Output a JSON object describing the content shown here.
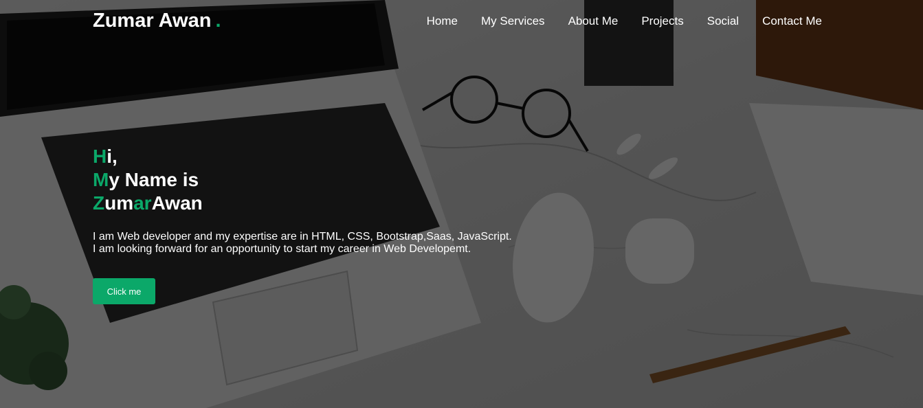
{
  "navbar": {
    "brand_name": "Zumar Awan",
    "brand_dot": ".",
    "links": [
      "Home",
      "My Services",
      "About Me",
      "Projects",
      "Social",
      "Contact Me"
    ]
  },
  "hero": {
    "line1": {
      "accent": "H",
      "rest": "i,"
    },
    "line2": {
      "accent": "M",
      "rest": "y Name is"
    },
    "line3": {
      "accent1": "Z",
      "mid": "um",
      "accent2": "ar",
      "rest": "Awan"
    },
    "description_line1": "I am Web developer and my expertise are in HTML, CSS, Bootstrap,Saas, JavaScript.",
    "description_line2": "I am looking forward for an opportunity to start my career in Web Developemt.",
    "button_label": "Click me"
  },
  "colors": {
    "accent": "#0ba869",
    "text": "#ffffff",
    "overlay": "rgba(0,0,0,0.58)"
  },
  "background": {
    "description_icon": "desk-photo-laptop-glasses-mouse-icon"
  }
}
